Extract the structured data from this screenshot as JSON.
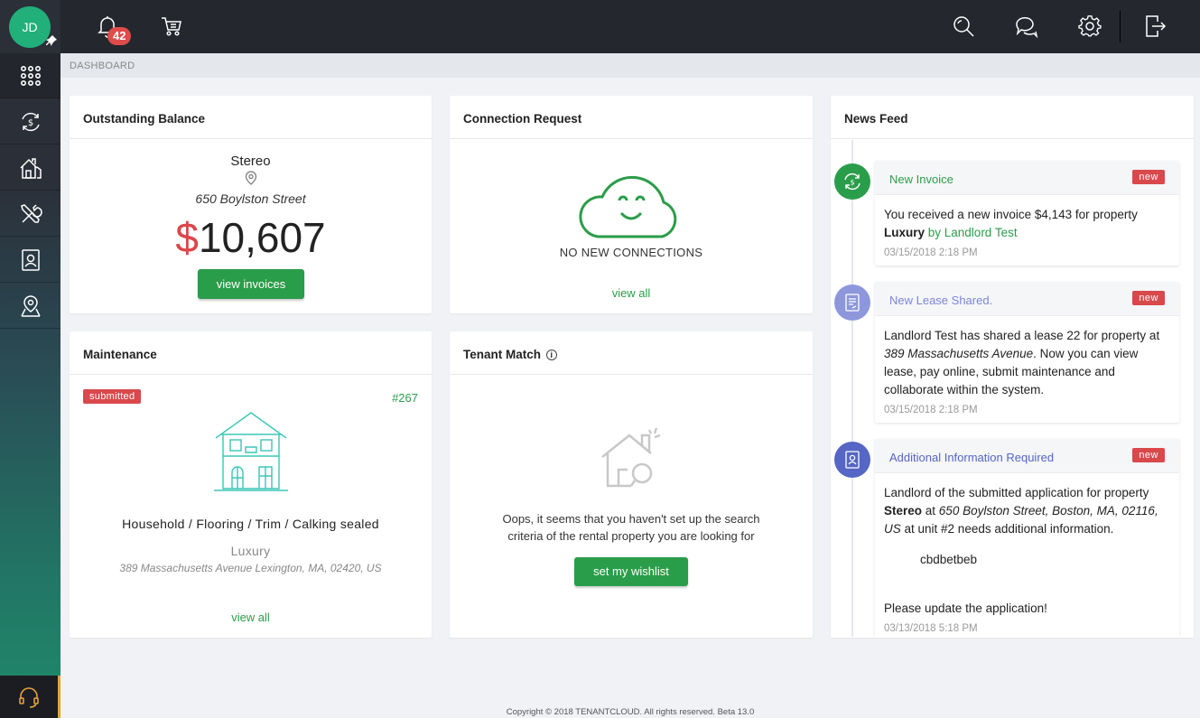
{
  "user": {
    "initials": "JD"
  },
  "header": {
    "notification_count": "42"
  },
  "breadcrumb": "DASHBOARD",
  "outstanding": {
    "title": "Outstanding Balance",
    "property": "Stereo",
    "address": "650 Boylston Street",
    "currency": "$",
    "amount": "10,607",
    "button": "view invoices"
  },
  "connection": {
    "title": "Connection Request",
    "empty_text": "NO NEW CONNECTIONS",
    "link": "view all"
  },
  "maintenance": {
    "title": "Maintenance",
    "status": "submitted",
    "number": "#267",
    "category": "Household / Flooring / Trim / Calking sealed",
    "property": "Luxury",
    "address": "389 Massachusetts Avenue Lexington, MA, 02420, US",
    "link": "view all"
  },
  "tenant_match": {
    "title": "Tenant Match",
    "info": "i",
    "line1": "Oops, it seems that you haven't set up the search",
    "line2": "criteria of the rental property you are looking for",
    "button": "set my wishlist"
  },
  "news_feed": {
    "title": "News Feed",
    "items": [
      {
        "title": "New Invoice",
        "badge": "new",
        "text_a": "You received a new invoice $4,143 for property ",
        "bold": "Luxury",
        "link": " by Landlord Test",
        "date": "03/15/2018 2:18 PM",
        "color": "#2a9d4a"
      },
      {
        "title": "New Lease Shared.",
        "badge": "new",
        "text_a": "Landlord Test has shared a lease 22 for property at ",
        "italic": "389 Massachusetts Avenue",
        "text_b": ". Now you can view lease, pay online, submit maintenance and collaborate within the system.",
        "date": "03/15/2018 2:18 PM",
        "color": "#7b86d6"
      },
      {
        "title": "Additional Information Required",
        "badge": "new",
        "text_a": "Landlord of the submitted application for property ",
        "bold": "Stereo",
        "text_b": " at ",
        "italic": "650 Boylston Street, Boston, MA, 02116, US",
        "text_c": " at unit #2 needs additional information.",
        "note": "cbdbetbeb",
        "text_d": "Please update the application!",
        "date": "03/13/2018 5:18 PM",
        "color": "#5566c4"
      }
    ]
  },
  "footer": "Copyright © 2018 TENANTCLOUD. All rights reserved. Beta 13.0"
}
